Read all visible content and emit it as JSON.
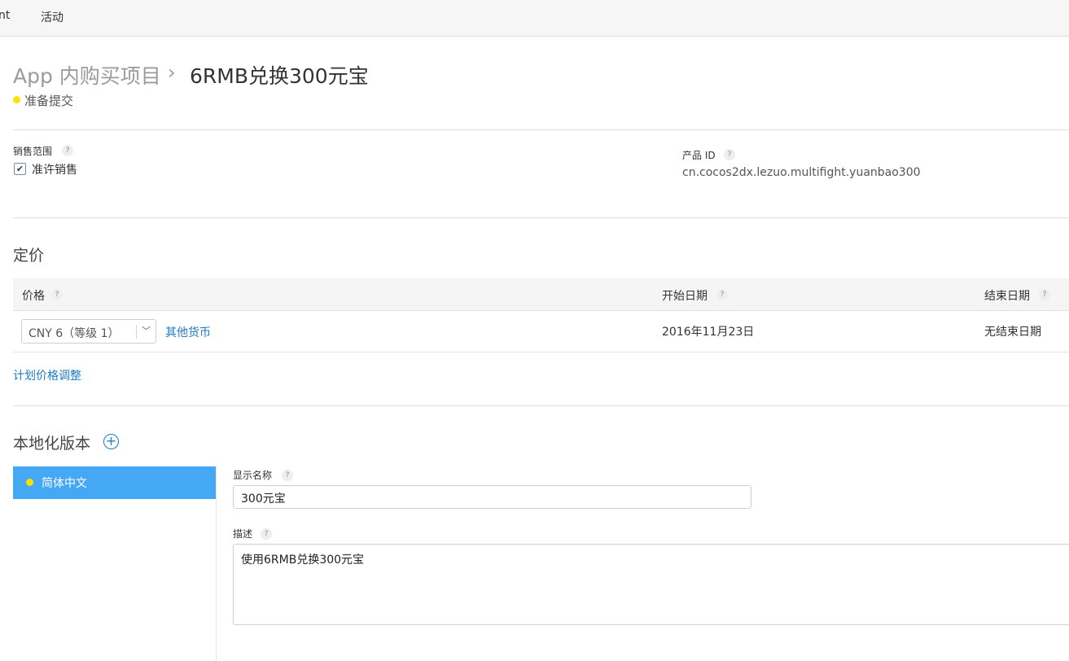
{
  "topnav": {
    "items": [
      "nt",
      "活动"
    ]
  },
  "breadcrumb": {
    "parent": "App 内购买项目",
    "separator": "›",
    "current": "6RMB兑换300元宝"
  },
  "status": {
    "label": "准备提交",
    "color": "#ffe100"
  },
  "help_glyph": "?",
  "availability": {
    "label": "销售范围",
    "checkbox_label": "准许销售",
    "checked": true,
    "check_glyph": "✔"
  },
  "product_id": {
    "label": "产品 ID",
    "value": "cn.cocos2dx.lezuo.multifight.yuanbao300"
  },
  "pricing": {
    "title": "定价",
    "columns": [
      "价格",
      "开始日期",
      "结束日期"
    ],
    "row": {
      "price_select": "CNY 6（等级 1）",
      "other_currencies_link": "其他货币",
      "start_date": "2016年11月23日",
      "end_date": "无结束日期"
    },
    "plan_link": "计划价格调整"
  },
  "localization": {
    "title": "本地化版本",
    "add_glyph": "+",
    "languages": [
      {
        "label": "简体中文",
        "selected": true
      }
    ],
    "display_name_label": "显示名称",
    "display_name_value": "300元宝",
    "description_label": "描述",
    "description_value": "使用6RMB兑换300元宝"
  },
  "colors": {
    "accent": "#45a8f5",
    "link": "#1a7ac4",
    "status_dot": "#ffe100"
  }
}
